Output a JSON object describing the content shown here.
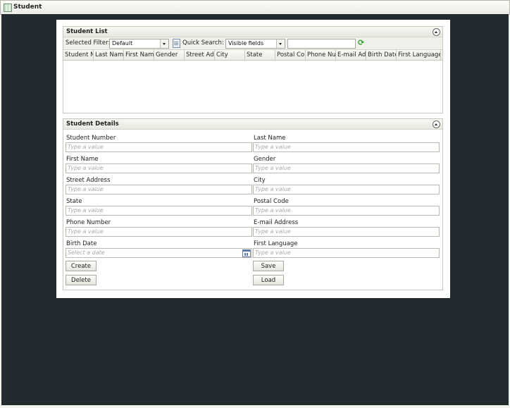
{
  "window": {
    "title": "Student"
  },
  "student_list": {
    "title": "Student List",
    "selected_filter_label": "Selected Filter:",
    "selected_filter_value": "Default",
    "quick_search_label": "Quick Search:",
    "quick_search_scope": "Visible fields",
    "quick_search_value": "",
    "columns": [
      "Student N",
      "Last Name",
      "First Name",
      "Gender",
      "Street Ad",
      "City",
      "State",
      "Postal Co",
      "Phone Nu",
      "E-mail Ad",
      "Birth Date",
      "First Language"
    ],
    "rows": []
  },
  "student_details": {
    "title": "Student Details",
    "fields": [
      {
        "label": "Student Number",
        "placeholder": "Type a value"
      },
      {
        "label": "Last Name",
        "placeholder": "Type a value"
      },
      {
        "label": "First Name",
        "placeholder": "Type a value"
      },
      {
        "label": "Gender",
        "placeholder": "Type a value"
      },
      {
        "label": "Street Address",
        "placeholder": "Type a value"
      },
      {
        "label": "City",
        "placeholder": "Type a value"
      },
      {
        "label": "State",
        "placeholder": "Type a value"
      },
      {
        "label": "Postal Code",
        "placeholder": "Type a value"
      },
      {
        "label": "Phone Number",
        "placeholder": "Type a value"
      },
      {
        "label": "E-mail Address",
        "placeholder": "Type a value"
      },
      {
        "label": "Birth Date",
        "placeholder": "Select a date"
      },
      {
        "label": "First Language",
        "placeholder": "Type a value"
      }
    ],
    "buttons": {
      "create": "Create",
      "save": "Save",
      "delete": "Delete",
      "load": "Load"
    }
  },
  "icons": [
    "app-icon",
    "collapse-icon",
    "dropdown-arrow-icon",
    "filter-document-icon",
    "refresh-icon",
    "calendar-icon"
  ],
  "colors": {
    "desktop": "#212b30",
    "refresh_icon": "#2e9a2e",
    "calendar_icon": "#5e78a8"
  }
}
